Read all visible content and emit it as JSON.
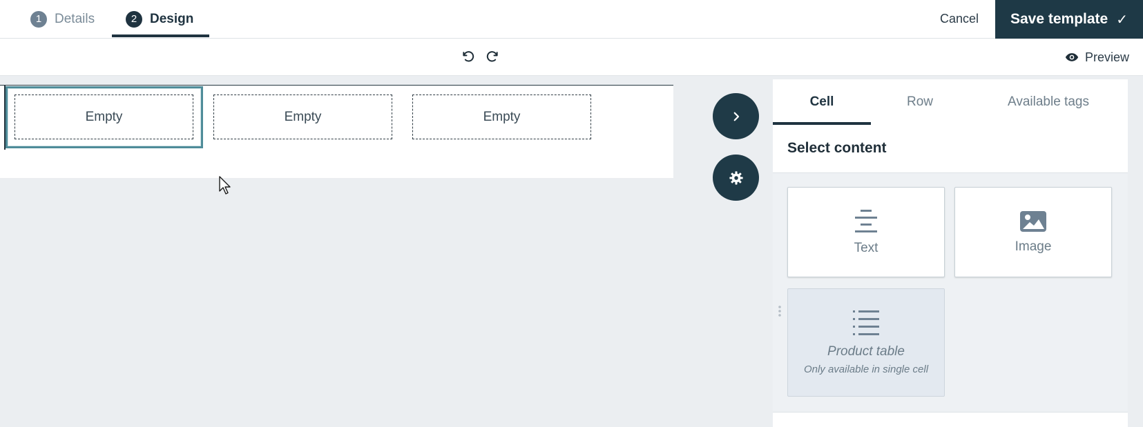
{
  "header": {
    "steps": [
      {
        "number": "1",
        "label": "Details"
      },
      {
        "number": "2",
        "label": "Design"
      }
    ],
    "cancel_label": "Cancel",
    "save_label": "Save template"
  },
  "toolbar": {
    "undo_icon": "undo-icon",
    "redo_icon": "redo-icon",
    "preview_label": "Preview"
  },
  "canvas": {
    "cells": [
      {
        "label": "Empty",
        "selected": true
      },
      {
        "label": "Empty",
        "selected": false
      },
      {
        "label": "Empty",
        "selected": false
      }
    ]
  },
  "panel": {
    "tabs": [
      {
        "label": "Cell",
        "active": true
      },
      {
        "label": "Row",
        "active": false
      },
      {
        "label": "Available tags",
        "active": false
      }
    ],
    "heading": "Select content",
    "tiles": [
      {
        "label": "Text",
        "icon": "align-center-icon"
      },
      {
        "label": "Image",
        "icon": "image-icon"
      },
      {
        "label": "Product table",
        "sub": "Only available in single cell",
        "icon": "list-icon",
        "disabled": true
      }
    ]
  },
  "colors": {
    "primary": "#1e3946",
    "selected_border": "#4f8c99",
    "canvas_bg": "#ebeef1",
    "muted_text": "#6b7c88"
  }
}
